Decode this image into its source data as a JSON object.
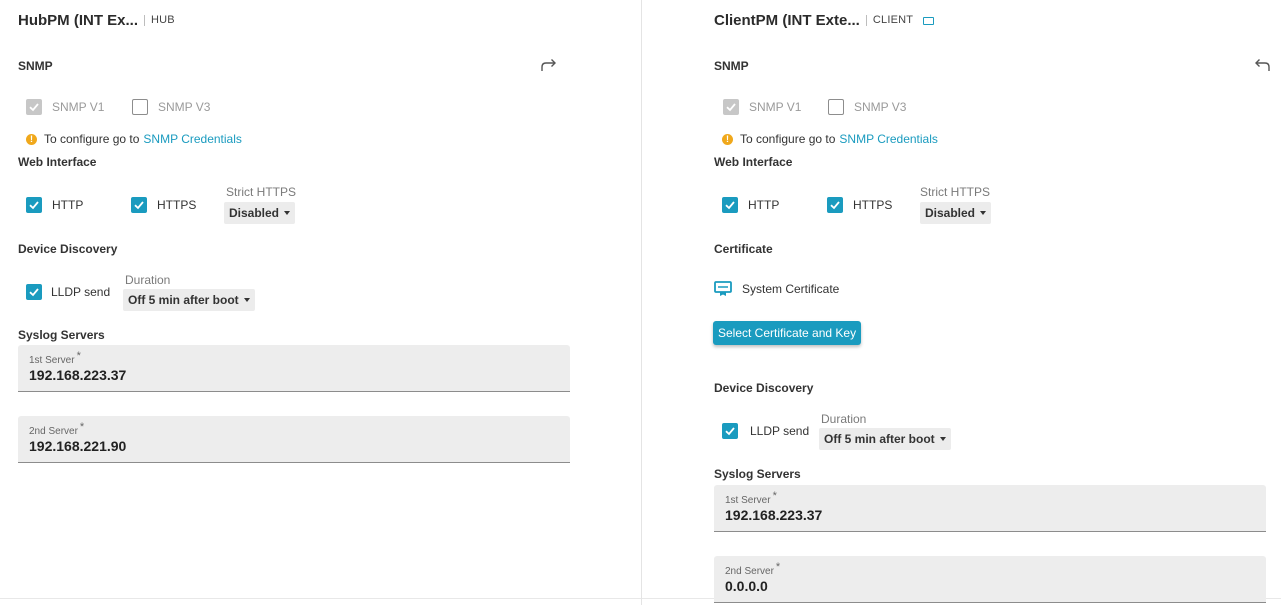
{
  "hub": {
    "title": "HubPM (INT Ex...",
    "tag": "HUB",
    "snmp": {
      "label": "SNMP",
      "arrow_icon": "forward-arrow-icon",
      "v1_label": "SNMP V1",
      "v1_checked": true,
      "v3_label": "SNMP V3",
      "v3_checked": false,
      "info_text": "To configure go to",
      "info_link": "SNMP Credentials"
    },
    "web_interface": {
      "label": "Web Interface",
      "http_label": "HTTP",
      "https_label": "HTTPS",
      "strict_caption": "Strict HTTPS",
      "strict_value": "Disabled"
    },
    "device_discovery": {
      "label": "Device Discovery",
      "lldp_label": "LLDP send",
      "duration_caption": "Duration",
      "duration_value": "Off 5 min after boot"
    },
    "syslog": {
      "label": "Syslog Servers",
      "server1_label": "1st Server",
      "server1_value": "192.168.223.37",
      "server2_label": "2nd Server",
      "server2_value": "192.168.221.90"
    }
  },
  "client": {
    "title": "ClientPM (INT Exte...",
    "tag": "CLIENT",
    "tag_icon": "laptop-icon",
    "snmp": {
      "label": "SNMP",
      "arrow_icon": "back-arrow-icon",
      "v1_label": "SNMP V1",
      "v1_checked": true,
      "v3_label": "SNMP V3",
      "v3_checked": false,
      "info_text": "To configure go to",
      "info_link": "SNMP Credentials"
    },
    "web_interface": {
      "label": "Web Interface",
      "http_label": "HTTP",
      "https_label": "HTTPS",
      "strict_caption": "Strict HTTPS",
      "strict_value": "Disabled"
    },
    "certificate": {
      "label": "Certificate",
      "icon": "certificate-icon",
      "name": "System Certificate",
      "button_label": "Select Certificate and Key"
    },
    "device_discovery": {
      "label": "Device Discovery",
      "lldp_label": "LLDP send",
      "duration_caption": "Duration",
      "duration_value": "Off 5 min after boot"
    },
    "syslog": {
      "label": "Syslog Servers",
      "server1_label": "1st Server",
      "server1_value": "192.168.223.37",
      "server2_label": "2nd Server",
      "server2_value": "0.0.0.0"
    }
  },
  "colors": {
    "accent": "#1a9bbf",
    "warning": "#f0a81b",
    "field_bg": "#ededed"
  }
}
